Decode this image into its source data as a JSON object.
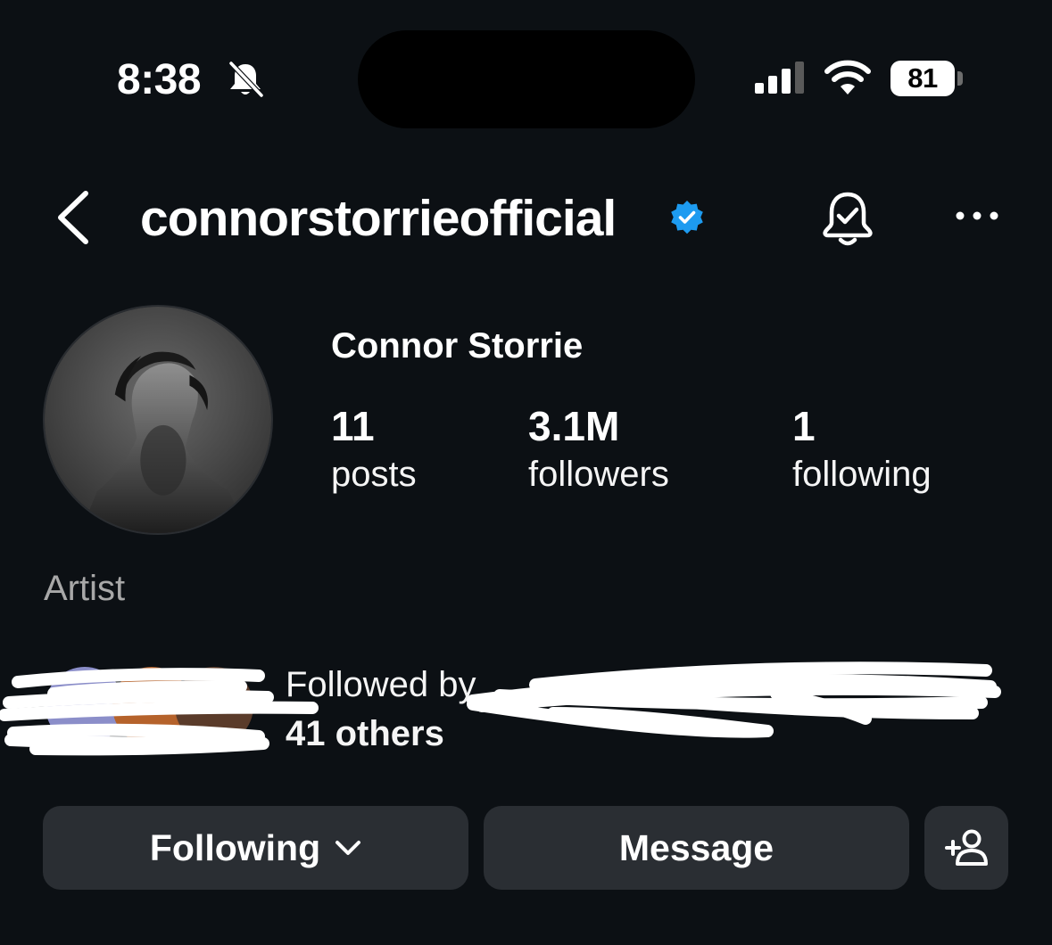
{
  "status_bar": {
    "time": "8:38",
    "battery": "81",
    "icons": [
      "bell-off-icon",
      "signal-icon",
      "wifi-icon",
      "battery-icon"
    ]
  },
  "header": {
    "username": "connorstorrieofficial",
    "verified": true,
    "icons": [
      "back-icon",
      "verified-badge-icon",
      "notification-bell-icon",
      "more-icon"
    ]
  },
  "profile": {
    "display_name": "Connor Storrie",
    "stats": [
      {
        "value": "11",
        "label": "posts"
      },
      {
        "value": "3.1M",
        "label": "followers"
      },
      {
        "value": "1",
        "label": "following"
      }
    ],
    "category": "Artist"
  },
  "followed_by": {
    "prefix": "Followed by",
    "others": "41 others"
  },
  "actions": {
    "following_label": "Following",
    "message_label": "Message",
    "suggest_icon": "add-person-icon"
  },
  "colors": {
    "background": "#0c1014",
    "button": "#2a2e33",
    "verified": "#1d9bf0",
    "secondary_text": "#a8a8a8"
  }
}
